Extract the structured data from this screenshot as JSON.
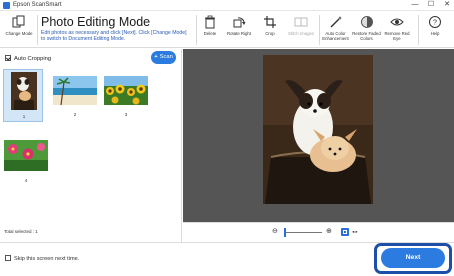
{
  "window": {
    "title": "Epson ScanSmart",
    "controls": [
      "—",
      "☐",
      "✕"
    ]
  },
  "toolbar": {
    "change_mode": "Change Mode",
    "mode_title": "Photo Editing Mode",
    "mode_description": "Edit photos as necessary and click [Next]. Click [Change Mode] to switch to Document Editing Mode.",
    "buttons": [
      {
        "label": "Delete",
        "icon": "trash-icon",
        "enabled": true
      },
      {
        "label": "Rotate Right",
        "icon": "rotate-right-icon",
        "enabled": true
      },
      {
        "label": "Crop",
        "icon": "crop-icon",
        "enabled": true
      },
      {
        "label": "Stitch Images",
        "icon": "stitch-icon",
        "enabled": false
      },
      {
        "label": "Auto Color Enhancement",
        "icon": "magic-wand-icon",
        "enabled": true
      },
      {
        "label": "Restore Faded Colors",
        "icon": "restore-colors-icon",
        "enabled": true
      },
      {
        "label": "Remove Red Eye",
        "icon": "eye-icon",
        "enabled": true
      },
      {
        "label": "Help",
        "icon": "help-icon",
        "enabled": true
      }
    ]
  },
  "left_pane": {
    "auto_cropping_label": "Auto Cropping",
    "auto_cropping_checked": true,
    "scan_button": "Scan",
    "thumbnails": [
      {
        "number": "1",
        "subject": "dogs",
        "selected": true
      },
      {
        "number": "2",
        "subject": "beach",
        "selected": false
      },
      {
        "number": "3",
        "subject": "sunflowers",
        "selected": false
      },
      {
        "number": "4",
        "subject": "flowers",
        "selected": false
      }
    ],
    "total_selected": "Total selected : 1"
  },
  "footer": {
    "skip_label": "Skip this screen next time.",
    "next_button": "Next"
  },
  "colors": {
    "accent": "#2b7be0",
    "focus_outline": "#1c4fa8",
    "preview_background": "#555555",
    "link_text": "#2a5bb8"
  }
}
